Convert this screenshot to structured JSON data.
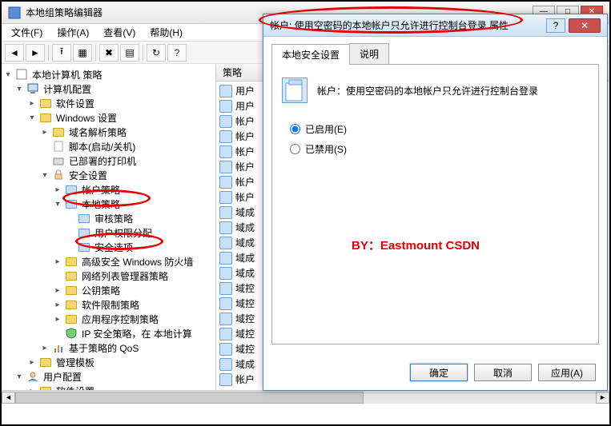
{
  "window": {
    "title": "本地组策略编辑器",
    "menus": {
      "file": "文件(F)",
      "action": "操作(A)",
      "view": "查看(V)",
      "help": "帮助(H)"
    }
  },
  "tree": {
    "root": "本地计算机 策略",
    "computer_config": "计算机配置",
    "software_settings": "软件设置",
    "windows_settings": "Windows 设置",
    "dns_policy": "域名解析策略",
    "scripts": "脚本(启动/关机)",
    "deployed_printers": "已部署的打印机",
    "security_settings": "安全设置",
    "account_policy": "帐户策略",
    "local_policy": "本地策略",
    "audit_policy": "审核策略",
    "user_rights": "用户权限分配",
    "security_options": "安全选项",
    "adv_firewall": "高级安全 Windows 防火墙",
    "netlist_mgr": "网络列表管理器策略",
    "public_key": "公钥策略",
    "software_restrict": "软件限制策略",
    "app_control": "应用程序控制策略",
    "ip_security": "IP 安全策略，在 本地计算",
    "qos": "基于策略的 QoS",
    "admin_templates": "管理模板",
    "user_config": "用户配置",
    "software_settings2": "软件设置"
  },
  "list": {
    "header": "策略",
    "rows": [
      "用户",
      "用户",
      "帐户",
      "帐户",
      "帐户",
      "帐户",
      "帐户",
      "帐户",
      "域成",
      "域成",
      "域成",
      "域成",
      "域成",
      "域控",
      "域控",
      "域控",
      "域控",
      "域控",
      "域成",
      "帐户"
    ]
  },
  "dialog": {
    "title": "帐户: 使用空密码的本地帐户只允许进行控制台登录 属性",
    "tab_local": "本地安全设置",
    "tab_explain": "说明",
    "policy_name": "帐户：使用空密码的本地帐户只允许进行控制台登录",
    "enabled": "已启用(E)",
    "disabled": "已禁用(S)",
    "watermark": "BY：Eastmount CSDN",
    "ok": "确定",
    "cancel": "取消",
    "apply": "应用(A)"
  }
}
